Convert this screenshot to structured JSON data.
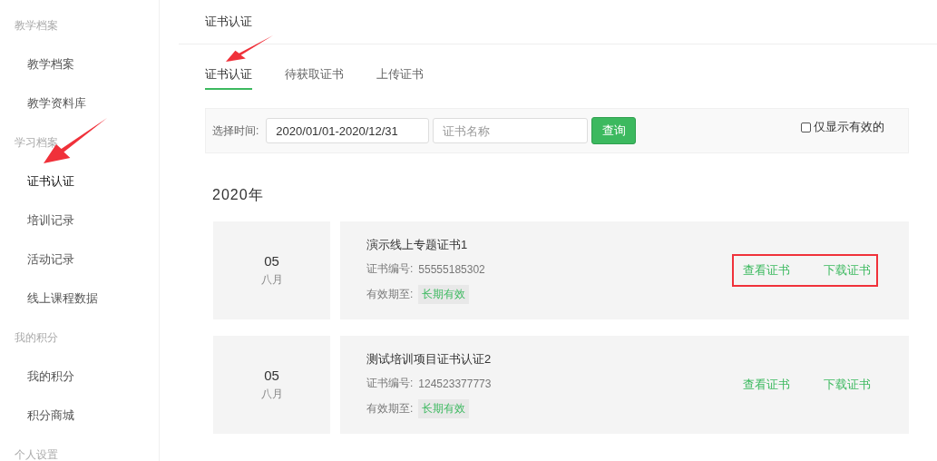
{
  "sidebar": {
    "sections": [
      {
        "title": "教学档案",
        "items": [
          {
            "label": "教学档案",
            "selected": false,
            "arrow": false
          },
          {
            "label": "教学资料库",
            "selected": false,
            "arrow": false
          }
        ]
      },
      {
        "title": "学习档案",
        "items": [
          {
            "label": "证书认证",
            "selected": true,
            "arrow": true
          },
          {
            "label": "培训记录",
            "selected": false,
            "arrow": false
          },
          {
            "label": "活动记录",
            "selected": false,
            "arrow": false
          },
          {
            "label": "线上课程数据",
            "selected": false,
            "arrow": false
          }
        ]
      },
      {
        "title": "我的积分",
        "items": [
          {
            "label": "我的积分",
            "selected": false,
            "arrow": false
          },
          {
            "label": "积分商城",
            "selected": false,
            "arrow": false
          }
        ]
      },
      {
        "title": "个人设置"
      }
    ]
  },
  "page_title": "证书认证",
  "tabs": [
    {
      "label": "证书认证",
      "selected": true,
      "arrow": true
    },
    {
      "label": "待获取证书",
      "selected": false,
      "arrow": false
    },
    {
      "label": "上传证书",
      "selected": false,
      "arrow": false
    }
  ],
  "filter": {
    "label": "选择时间:",
    "date_range": "2020/01/01-2020/12/31",
    "name_placeholder": "证书名称",
    "search_button": "查询",
    "valid_only": {
      "label": "仅显示有效的",
      "checked": false
    }
  },
  "year": "2020年",
  "certificates": [
    {
      "day": "05",
      "month": "八月",
      "name": "演示线上专题证书1",
      "number_label": "证书编号:",
      "number": "55555185302",
      "validity_label": "有效期至:",
      "validity": "长期有效",
      "view": "查看证书",
      "download": "下载证书",
      "highlighted": true
    },
    {
      "day": "05",
      "month": "八月",
      "name": "测试培训项目证书认证2",
      "number_label": "证书编号:",
      "number": "124523377773",
      "validity_label": "有效期至:",
      "validity": "长期有效",
      "view": "查看证书",
      "download": "下载证书",
      "highlighted": false
    }
  ]
}
